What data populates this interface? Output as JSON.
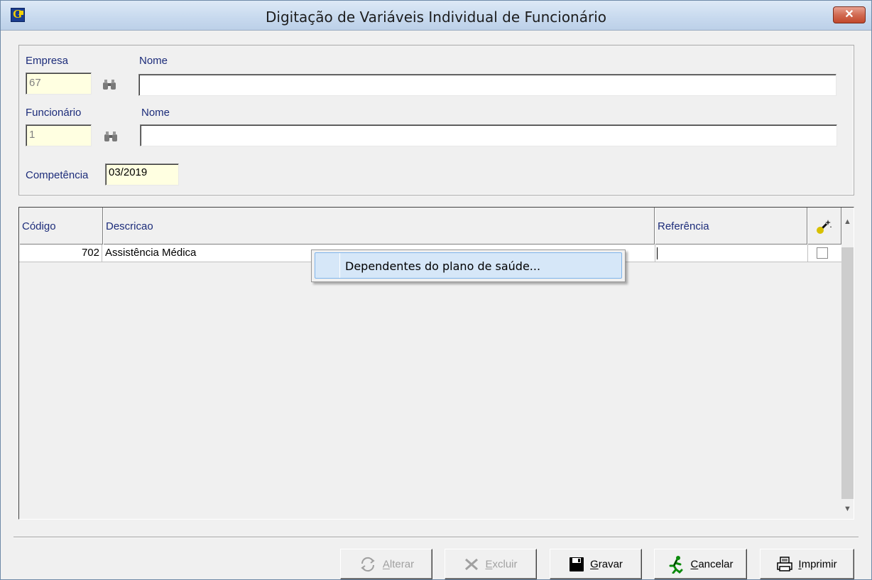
{
  "window": {
    "title": "Digitação de Variáveis Individual de Funcionário",
    "close_glyph": "✕"
  },
  "form": {
    "empresa_label": "Empresa",
    "empresa_value": "67",
    "empresa_nome_label": "Nome",
    "empresa_nome_value": "",
    "funcionario_label": "Funcionário",
    "funcionario_value": "1",
    "funcionario_nome_label": "Nome",
    "funcionario_nome_value": "",
    "competencia_label": "Competência",
    "competencia_value": "03/2019"
  },
  "grid": {
    "columns": {
      "codigo": "Código",
      "descricao": "Descricao",
      "referencia": "Referência"
    },
    "rows": [
      {
        "codigo": "702",
        "descricao": "Assistência Médica",
        "referencia": "",
        "checked": false
      }
    ]
  },
  "context_menu": {
    "item": "Dependentes do plano de saúde..."
  },
  "buttons": {
    "alterar": {
      "first": "A",
      "rest": "lterar"
    },
    "excluir": {
      "first": "E",
      "rest": "xcluir"
    },
    "gravar": {
      "first": "G",
      "rest": "ravar"
    },
    "cancelar": {
      "first": "C",
      "rest": "ancelar"
    },
    "imprimir": {
      "first": "I",
      "rest": "mprimir"
    }
  },
  "icons": {
    "app": "app-logo-icon",
    "search": "binoculars-icon",
    "column": "magic-wand-icon",
    "alterar": "refresh-icon",
    "excluir": "delete-icon",
    "gravar": "floppy-disk-icon",
    "cancelar": "running-man-icon",
    "imprimir": "printer-icon"
  },
  "colors": {
    "label_blue": "#1c2c7a",
    "field_yellow": "#ffffe1",
    "menu_highlight": "#d6e7f8"
  }
}
